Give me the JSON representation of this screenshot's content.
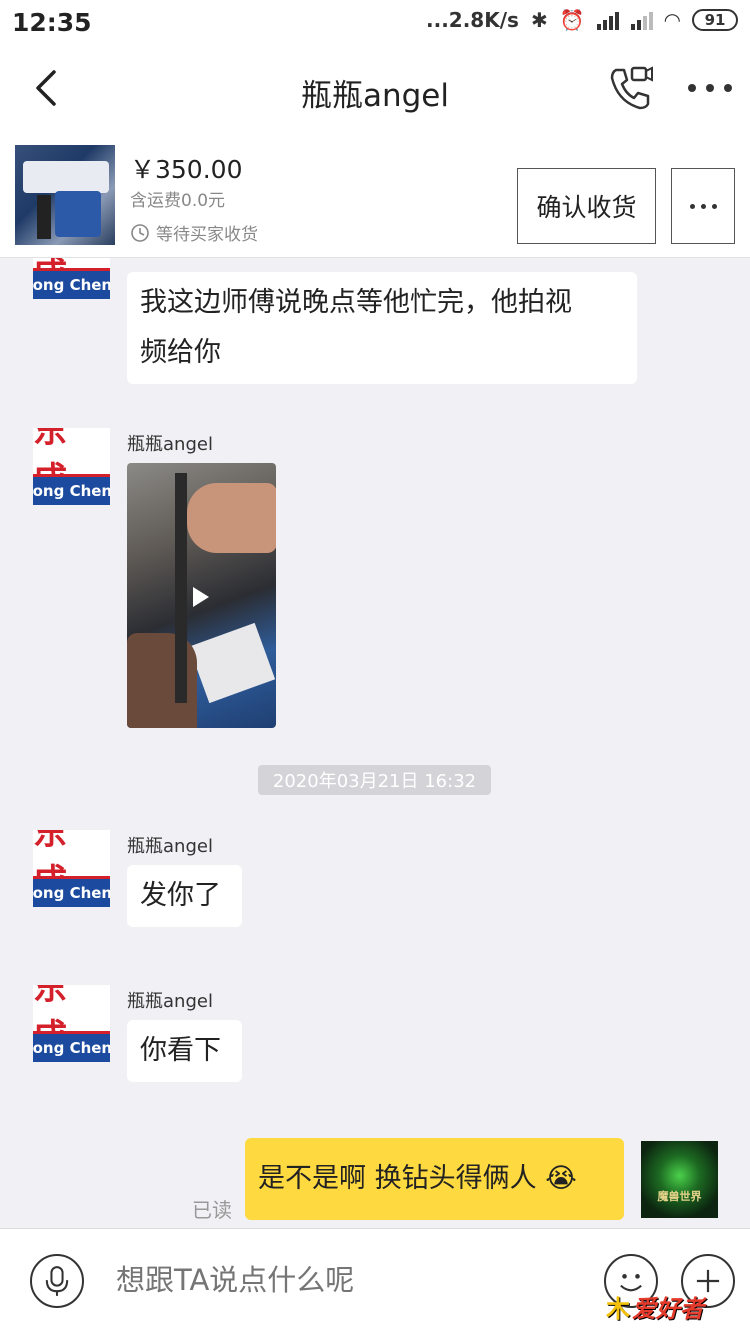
{
  "status_bar": {
    "time": "12:35",
    "net_speed": "...2.8K/s",
    "battery": "91"
  },
  "nav": {
    "title": "瓶瓶angel"
  },
  "order": {
    "price": "￥350.00",
    "shipping": "含运费0.0元",
    "status": "等待买家收货",
    "confirm_label": "确认收货"
  },
  "chat": {
    "messages": [
      {
        "sender": "",
        "text_line1": "我这边师傅说晚点等他忙完，他拍视",
        "text_line2": "频给你"
      },
      {
        "sender": "瓶瓶angel",
        "type": "video"
      },
      {
        "timestamp": "2020年03月21日 16:32"
      },
      {
        "sender": "瓶瓶angel",
        "text": "发你了"
      },
      {
        "sender": "瓶瓶angel",
        "text": "你看下"
      },
      {
        "sender": "me",
        "text": "是不是啊 换钻头得俩人",
        "emoji": "😭",
        "read_status": "已读"
      }
    ],
    "avatar_top": "东 成",
    "avatar_bottom": "Dong Cheng",
    "my_avatar_text": "魔兽世界"
  },
  "input": {
    "placeholder": "想跟TA说点什么呢"
  },
  "watermark": {
    "part1": "木",
    "part2": "爱好者"
  },
  "colors": {
    "my_bubble": "#ffd940",
    "brand_red": "#d4202a",
    "brand_blue": "#1c4a9e"
  }
}
